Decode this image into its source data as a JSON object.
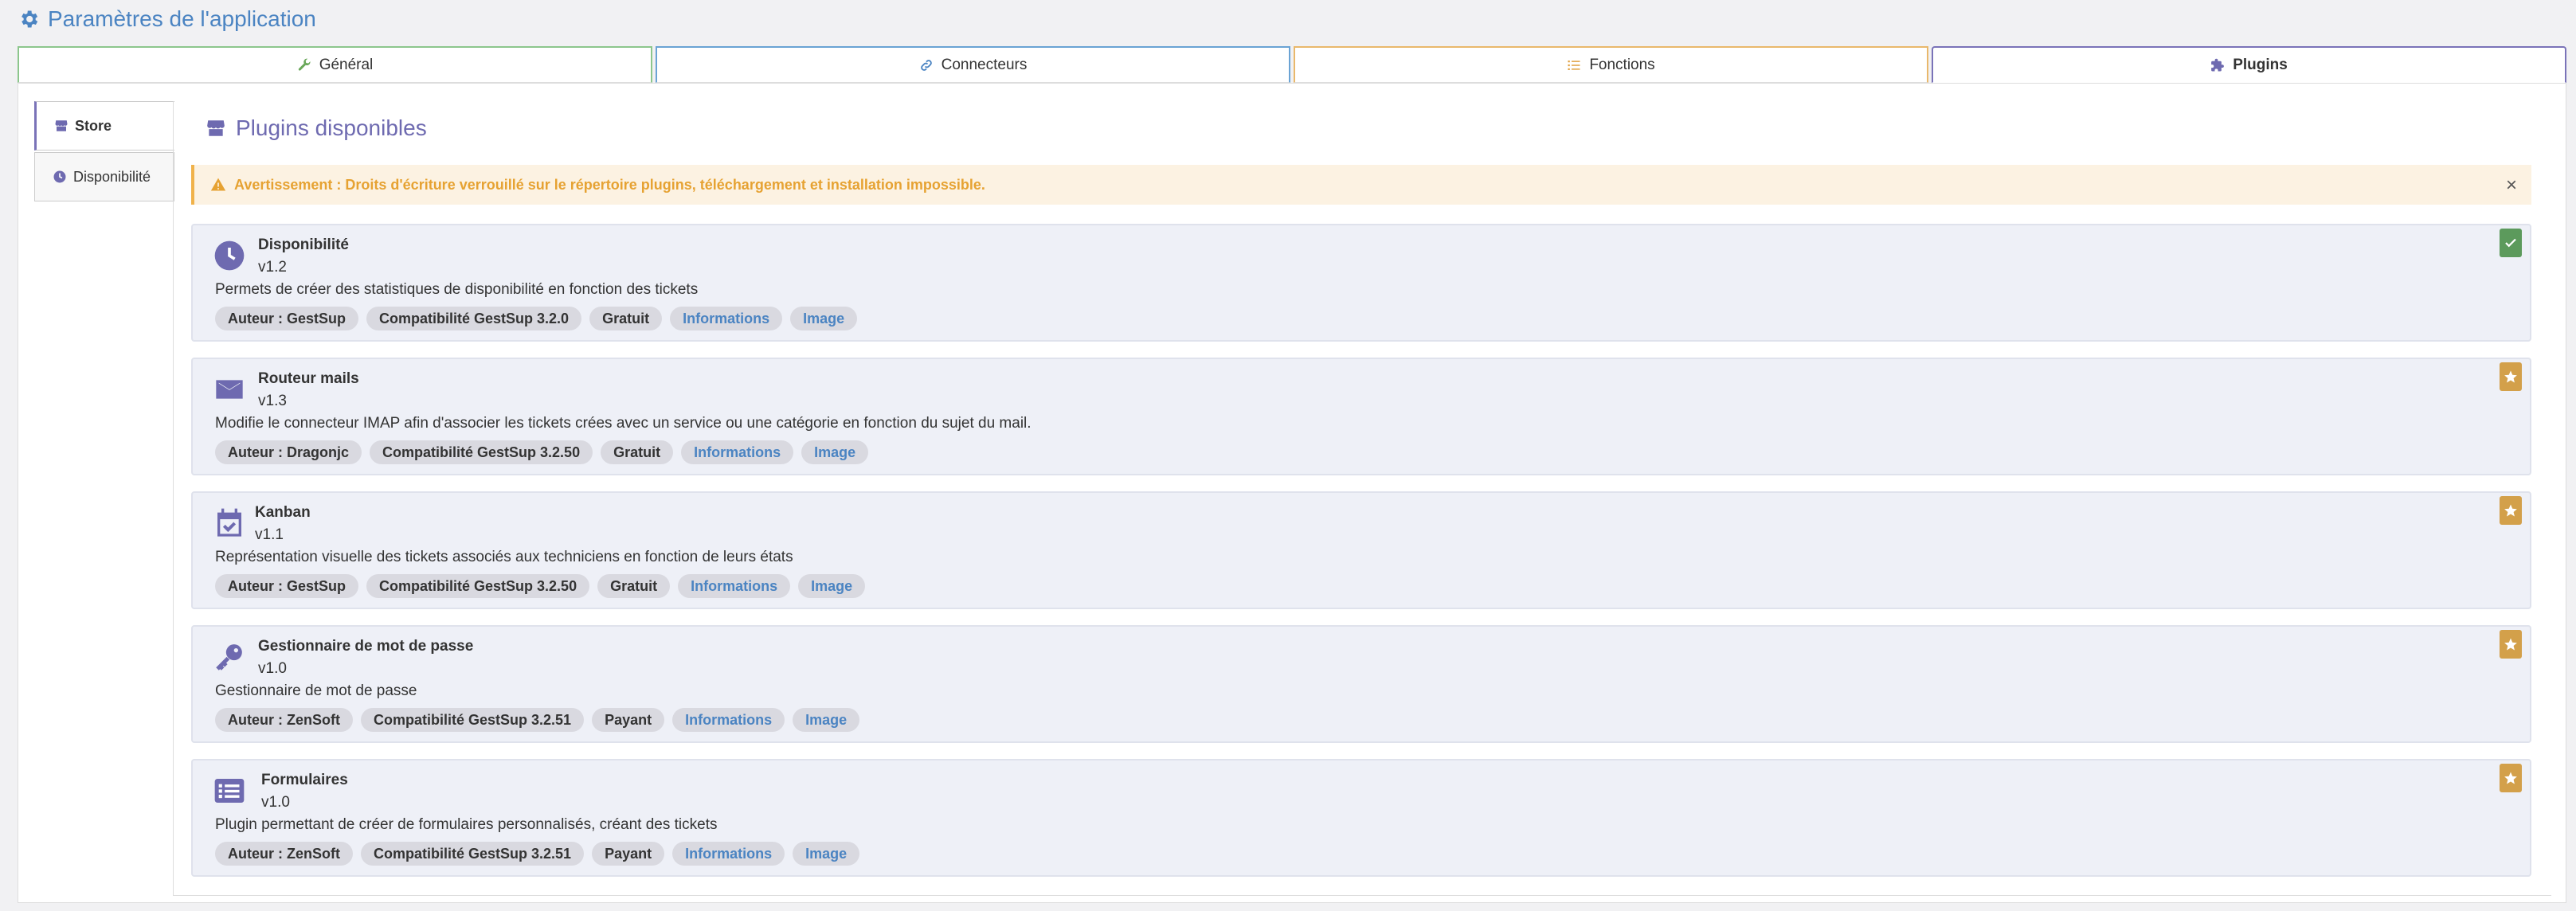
{
  "page": {
    "title": "Paramètres de l'application"
  },
  "tabs": [
    {
      "label": "Général",
      "icon": "wrench-icon"
    },
    {
      "label": "Connecteurs",
      "icon": "link-icon"
    },
    {
      "label": "Fonctions",
      "icon": "list-icon"
    },
    {
      "label": "Plugins",
      "icon": "puzzle-icon",
      "active": true
    }
  ],
  "sidenav": [
    {
      "label": "Store",
      "icon": "store-icon",
      "active": true
    },
    {
      "label": "Disponibilité",
      "icon": "clock-icon"
    }
  ],
  "content": {
    "title": "Plugins disponibles"
  },
  "alert": {
    "text": "Avertissement : Droits d'écriture verrouillé sur le répertoire plugins, téléchargement et installation impossible.",
    "close": "×"
  },
  "plugins": [
    {
      "name": "Disponibilité",
      "version": "v1.2",
      "description": "Permets de créer des statistiques de disponibilité en fonction des tickets",
      "author": "Auteur : GestSup",
      "compat": "Compatibilité GestSup 3.2.0",
      "price": "Gratuit",
      "info": "Informations",
      "image": "Image",
      "icon": "clock-icon",
      "status": "installed"
    },
    {
      "name": "Routeur mails",
      "version": "v1.3",
      "description": "Modifie le connecteur IMAP afin d'associer les tickets crées avec un service ou une catégorie en fonction du sujet du mail.",
      "author": "Auteur : Dragonjc",
      "compat": "Compatibilité GestSup 3.2.50",
      "price": "Gratuit",
      "info": "Informations",
      "image": "Image",
      "icon": "envelope-icon",
      "status": "available"
    },
    {
      "name": "Kanban",
      "version": "v1.1",
      "description": "Représentation visuelle des tickets associés aux techniciens en fonction de leurs états",
      "author": "Auteur : GestSup",
      "compat": "Compatibilité GestSup 3.2.50",
      "price": "Gratuit",
      "info": "Informations",
      "image": "Image",
      "icon": "calendar-check-icon",
      "status": "available"
    },
    {
      "name": "Gestionnaire de mot de passe",
      "version": "v1.0",
      "description": "Gestionnaire de mot de passe",
      "author": "Auteur : ZenSoft",
      "compat": "Compatibilité GestSup 3.2.51",
      "price": "Payant",
      "info": "Informations",
      "image": "Image",
      "icon": "key-icon",
      "status": "available"
    },
    {
      "name": "Formulaires",
      "version": "v1.0",
      "description": "Plugin permettant de créer de formulaires personnalisés, créant des tickets",
      "author": "Auteur : ZenSoft",
      "compat": "Compatibilité GestSup 3.2.51",
      "price": "Payant",
      "info": "Informations",
      "image": "Image",
      "icon": "list-alt-icon",
      "status": "available"
    }
  ],
  "colors": {
    "accent": "#6e6ab0",
    "title_blue": "#4b84c2",
    "warning": "#e6a232",
    "installed": "#5c9a5c",
    "available": "#d3a04a"
  }
}
